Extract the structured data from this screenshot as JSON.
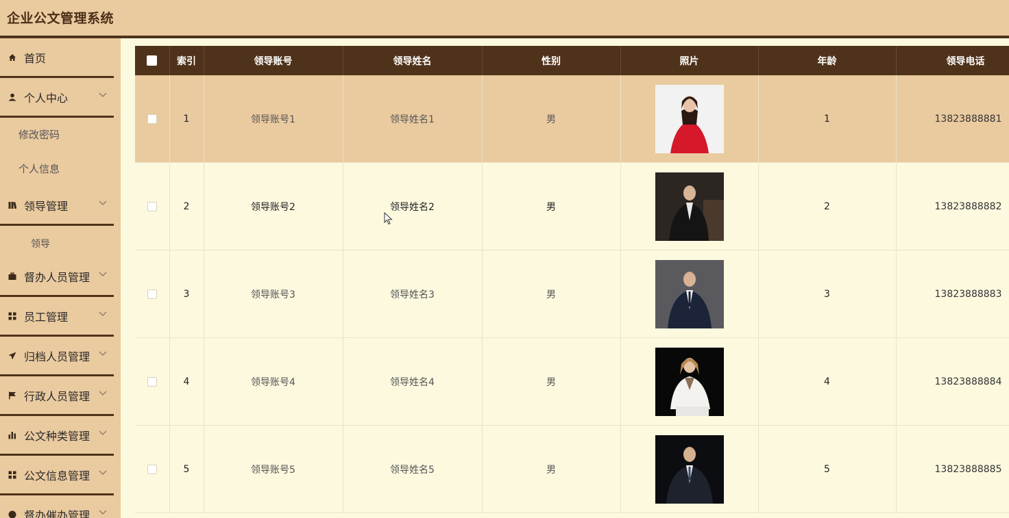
{
  "app": {
    "title": "企业公文管理系统"
  },
  "sidebar": {
    "items": [
      {
        "label": "首页",
        "icon": "home-icon"
      },
      {
        "label": "个人中心",
        "icon": "user-icon"
      },
      {
        "label": "修改密码"
      },
      {
        "label": "个人信息"
      },
      {
        "label": "领导管理",
        "icon": "book-icon"
      },
      {
        "label": "领导"
      },
      {
        "label": "督办人员管理",
        "icon": "briefcase-icon"
      },
      {
        "label": "员工管理",
        "icon": "grid-icon"
      },
      {
        "label": "归档人员管理",
        "icon": "send-icon"
      },
      {
        "label": "行政人员管理",
        "icon": "flag-icon"
      },
      {
        "label": "公文种类管理",
        "icon": "bar-chart-icon"
      },
      {
        "label": "公文信息管理",
        "icon": "grid-icon"
      },
      {
        "label": "督办催办管理",
        "icon": "pie-icon"
      }
    ]
  },
  "table": {
    "headers": [
      "索引",
      "领导账号",
      "领导姓名",
      "性别",
      "照片",
      "年龄",
      "领导电话"
    ],
    "rows": [
      {
        "index": "1",
        "account": "领导账号1",
        "name": "领导姓名1",
        "gender": "男",
        "photo": "woman in red blouse",
        "age": "1",
        "phone": "13823888881"
      },
      {
        "index": "2",
        "account": "领导账号2",
        "name": "领导姓名2",
        "gender": "男",
        "photo": "man in dark suit",
        "age": "2",
        "phone": "13823888882"
      },
      {
        "index": "3",
        "account": "领导账号3",
        "name": "领导姓名3",
        "gender": "男",
        "photo": "man in navy suit",
        "age": "3",
        "phone": "13823888883"
      },
      {
        "index": "4",
        "account": "领导账号4",
        "name": "领导姓名4",
        "gender": "男",
        "photo": "woman in white blazer",
        "age": "4",
        "phone": "13823888884"
      },
      {
        "index": "5",
        "account": "领导账号5",
        "name": "领导姓名5",
        "gender": "男",
        "photo": "man in dark suit seated",
        "age": "5",
        "phone": "13823888885"
      }
    ]
  },
  "colors": {
    "header_bg": "#eaca9f",
    "accent_dark": "#4f321a",
    "row_bg": "#fcf9df"
  }
}
